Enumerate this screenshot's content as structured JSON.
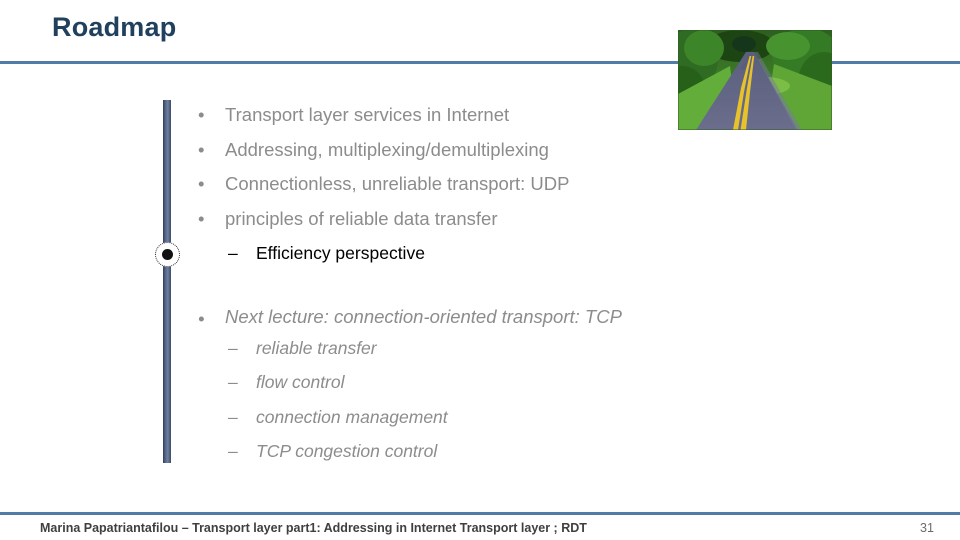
{
  "slide": {
    "title": "Roadmap",
    "page_number": "31",
    "footer": "Marina Papatriantafilou –  Transport layer part1: Addressing in Internet Transport layer ; RDT"
  },
  "theme": {
    "title_color": "#20405e",
    "rule_color": "#517ca8",
    "body_gray": "#8c8c8c",
    "highlight_black": "#000000",
    "bar_color": "#4a5a7c"
  },
  "marks": {
    "bullet_glyph": "•",
    "dash_glyph": "–"
  },
  "image": {
    "name": "road-through-trees-photo",
    "alt": "Photograph of a two-lane road with yellow centre lines curving through green trees"
  },
  "groups": [
    {
      "id": "covered",
      "italic": false,
      "items": [
        {
          "level": 1,
          "text": "Transport layer services in Internet",
          "color": "gray"
        },
        {
          "level": 1,
          "text": "Addressing, multiplexing/demultiplexing",
          "color": "gray"
        },
        {
          "level": 1,
          "text": "Connectionless, unreliable transport: UDP",
          "color": "gray"
        },
        {
          "level": 1,
          "text": "principles of reliable data transfer",
          "color": "gray"
        },
        {
          "level": 2,
          "text": "Efficiency perspective",
          "color": "black"
        }
      ]
    },
    {
      "id": "next",
      "italic": true,
      "items": [
        {
          "level": 1,
          "text": "Next lecture: connection-oriented transport: TCP",
          "color": "gray"
        },
        {
          "level": 2,
          "text": "reliable transfer",
          "color": "gray"
        },
        {
          "level": 2,
          "text": "flow control",
          "color": "gray"
        },
        {
          "level": 2,
          "text": "connection management",
          "color": "gray"
        },
        {
          "level": 2,
          "text": "TCP congestion control",
          "color": "gray"
        }
      ]
    }
  ]
}
